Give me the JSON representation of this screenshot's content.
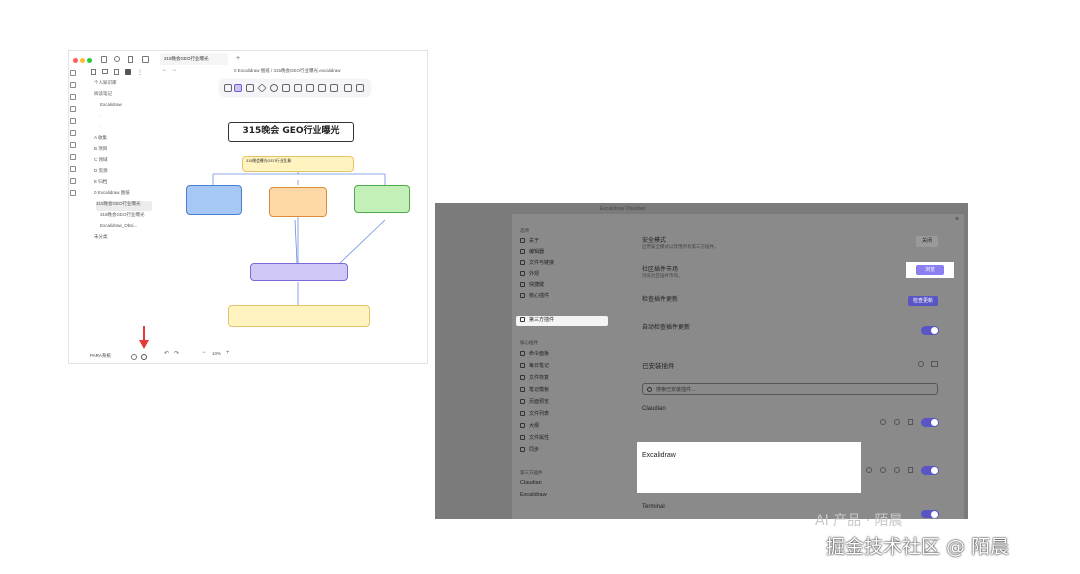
{
  "left_window": {
    "tab_label": "315晚会GEO行业曝光",
    "breadcrumb": "0 Excalidraw 图纸 / 315晚会GEO行业曝光.excalidraw",
    "sidebar_items": [
      "个人知识库",
      "阅读笔记",
      "Excalidraw",
      "A 收集",
      "B 项目",
      "C 领域",
      "D 资源",
      "E 归档",
      "0 Excalidraw 图纸",
      "315晚会GEO行业曝光",
      "315晚会GEO行业曝光",
      "Excalidraw_Obsi...",
      "未分类"
    ],
    "vault_name": "PARA系统",
    "zoom": "10%",
    "diagram": {
      "title": "315晚会 GEO行业曝光",
      "nodes": [
        {
          "id": "top",
          "text": "315晚会曝光GEO行业乱象"
        },
        {
          "id": "left",
          "text": ""
        },
        {
          "id": "center",
          "text": ""
        },
        {
          "id": "right",
          "text": ""
        },
        {
          "id": "mid",
          "text": ""
        },
        {
          "id": "bottom",
          "text": ""
        }
      ]
    }
  },
  "right_window": {
    "title_bar": "Excalidraw Obsidian",
    "sidebar_groups": [
      {
        "title": "选项",
        "items": [
          "关于",
          "编辑器",
          "文件与链接",
          "外观",
          "快捷键",
          "核心插件",
          "第三方插件"
        ]
      },
      {
        "title": "核心插件",
        "items": [
          "命令面板",
          "每日笔记",
          "文件恢复",
          "笔记模板",
          "页面预览",
          "文件列表",
          "大纲",
          "文件属性",
          "同步"
        ]
      },
      {
        "title": "第三方插件",
        "items": [
          "Claudian",
          "Excalidraw"
        ]
      }
    ],
    "settings": [
      {
        "title": "安全模式",
        "desc": "启用安全模式以禁用所有第三方插件。",
        "control": "button",
        "control_label": "关闭"
      },
      {
        "title": "社区插件市场",
        "desc": "浏览社区插件市场。",
        "control": "button",
        "control_label": "浏览"
      },
      {
        "title": "检查插件更新",
        "desc": "",
        "control": "button",
        "control_label": "检查更新"
      },
      {
        "title": "自动检查插件更新",
        "desc": "",
        "control": "toggle",
        "control_label": ""
      }
    ],
    "installed_header": "已安装插件",
    "search_placeholder": "搜索已安装插件...",
    "plugins": [
      {
        "name": "Claudian",
        "version": "",
        "author": "",
        "desc": "",
        "enabled": true
      },
      {
        "name": "Excalidraw",
        "version": "",
        "author": "",
        "desc": "",
        "enabled": true
      },
      {
        "name": "Terminal",
        "version": "",
        "author": "",
        "desc": "",
        "enabled": true
      }
    ]
  },
  "watermark": {
    "logo_text": "AI 产品 · 陌晨",
    "caption": "掘金技术社区 @ 陌晨"
  },
  "colors": {
    "accent": "#5a55c4",
    "arrow_red": "#e53935"
  }
}
